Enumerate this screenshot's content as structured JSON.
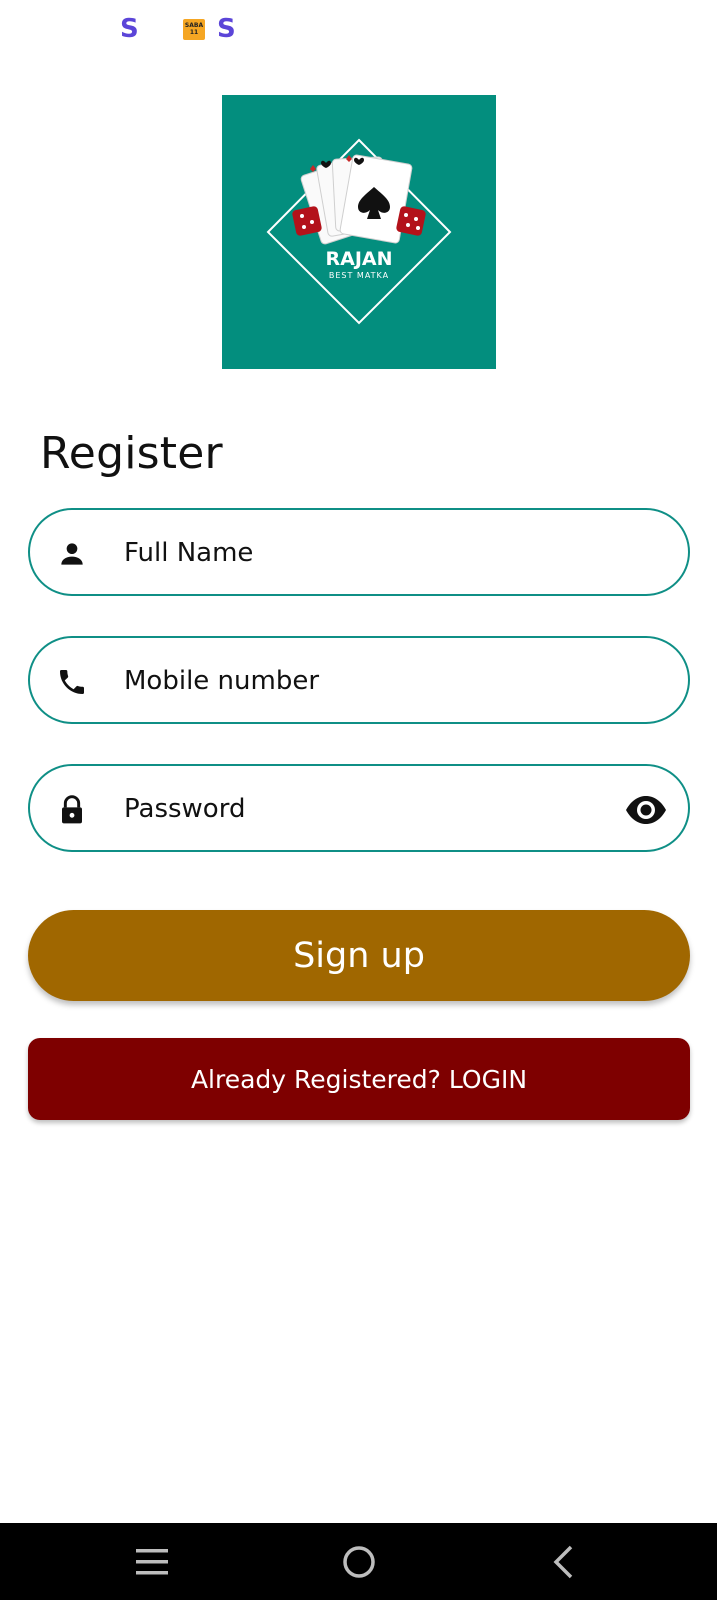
{
  "status_bar": {
    "icons": [
      "s-app-icon",
      "saba-app-icon",
      "s-app-icon"
    ],
    "s_glyph": "S",
    "badge_text": "SABA 11"
  },
  "logo": {
    "brand": "RAJAN",
    "tagline": "BEST MATKA",
    "background_color": "#038e7e"
  },
  "register": {
    "title": "Register",
    "full_name_placeholder": "Full Name",
    "mobile_placeholder": "Mobile number",
    "password_placeholder": "Password",
    "signup_label": "Sign up",
    "login_label": "Already Registered? LOGIN"
  },
  "colors": {
    "field_border": "#0f8f86",
    "signup_bg": "#a06700",
    "login_bg": "#7e0000"
  },
  "nav_bar": {
    "icons": [
      "menu-icon",
      "home-icon",
      "back-icon"
    ]
  }
}
